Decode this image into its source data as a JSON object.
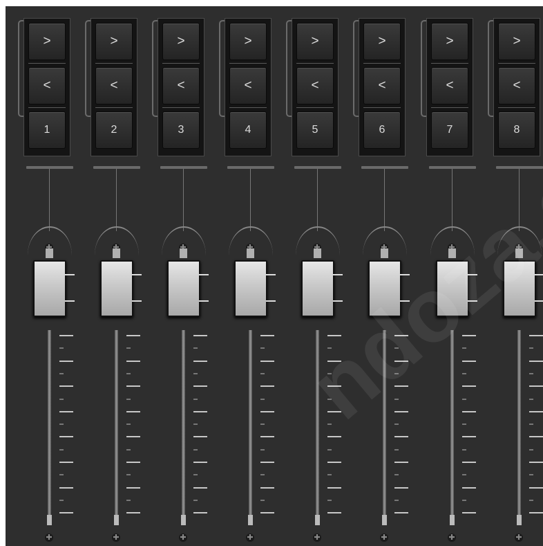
{
  "buttons": {
    "next": ">",
    "prev": "<"
  },
  "channels": [
    {
      "number": "1",
      "fader_level": 0.88
    },
    {
      "number": "2",
      "fader_level": 0.88
    },
    {
      "number": "3",
      "fader_level": 0.88
    },
    {
      "number": "4",
      "fader_level": 0.88
    },
    {
      "number": "5",
      "fader_level": 0.88
    },
    {
      "number": "6",
      "fader_level": 0.88
    },
    {
      "number": "7",
      "fader_level": 0.88
    },
    {
      "number": "8",
      "fader_level": 0.88
    }
  ],
  "watermark": "ndoza.c",
  "colors": {
    "panel": "#2e2e2e",
    "button": "#2a2a2a",
    "knob": "#c8c8c8",
    "tick": "#c8c8c8"
  }
}
